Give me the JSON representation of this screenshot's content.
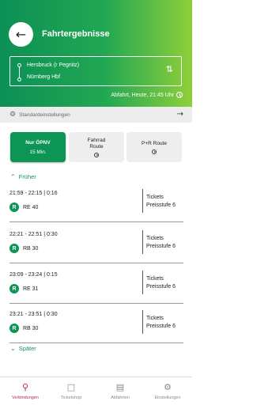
{
  "header": {
    "title": "Fahrtergebnisse",
    "route": {
      "from": "Hersbruck (r Pegnitz)",
      "to": "Nürnberg Hbf"
    },
    "departure": "Abfahrt, Heute, 21:45 Uhr"
  },
  "settings": {
    "label": "Standardeinstellungen"
  },
  "modes": [
    {
      "label": "Nur ÖPNV",
      "sub": "15 Min.",
      "active": true
    },
    {
      "label": "Fahrrad Route",
      "active": false
    },
    {
      "label": "P+R Route",
      "active": false
    }
  ],
  "nav": {
    "earlier": "Früher",
    "later": "Später"
  },
  "trips": [
    {
      "time": "21:59 - 22:15 | 0:16",
      "badge": "R",
      "line": "RE 40",
      "tickets": "Tickets",
      "tariff": "Preisstufe 6"
    },
    {
      "time": "22:21 - 22:51 | 0:30",
      "badge": "R",
      "line": "RB 30",
      "tickets": "Tickets",
      "tariff": "Preisstufe 6"
    },
    {
      "time": "23:09 - 23:24 | 0:15",
      "badge": "R",
      "line": "RE 31",
      "tickets": "Tickets",
      "tariff": "Preisstufe 6"
    },
    {
      "time": "23:21 - 23:51 | 0:30",
      "badge": "R",
      "line": "RB 30",
      "tickets": "Tickets",
      "tariff": "Preisstufe 6"
    }
  ],
  "bottom_nav": [
    {
      "label": "Verbindungen",
      "icon": "map-search-icon",
      "active": true
    },
    {
      "label": "Ticketshop",
      "icon": "ticket-icon",
      "active": false
    },
    {
      "label": "Abfahrten",
      "icon": "bus-icon",
      "active": false
    },
    {
      "label": "Einstellungen",
      "icon": "gear-icon",
      "active": false
    }
  ],
  "colors": {
    "primary_green": "#0c9555",
    "accent_active": "#b0275b",
    "gradient_end": "#8fcf3a"
  }
}
